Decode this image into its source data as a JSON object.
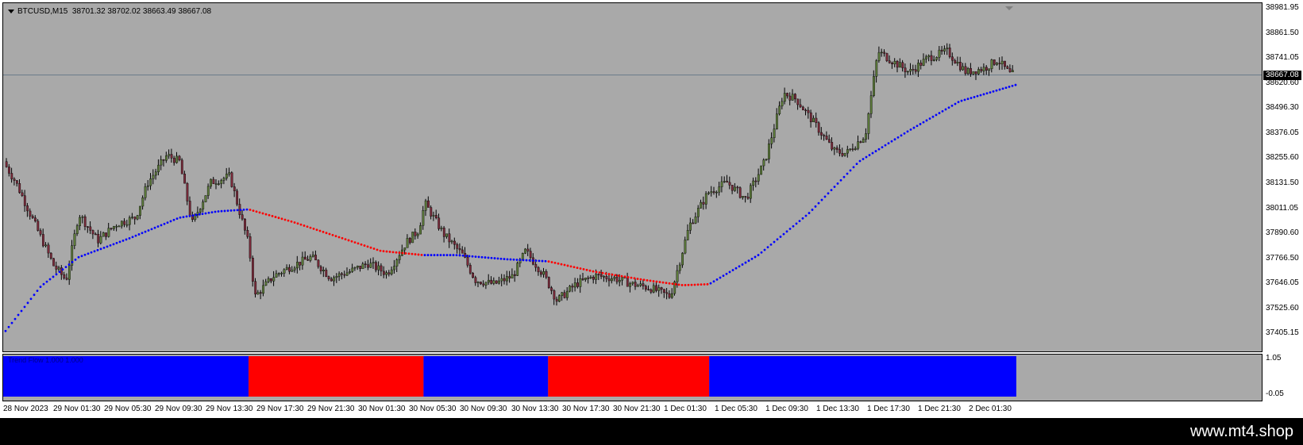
{
  "chart": {
    "symbol": "BTCUSD,M15",
    "ohlc": "38701.32 38702.02 38663.49 38667.08",
    "current_price": "38667.08"
  },
  "price_scale": {
    "labels": [
      "38981.95",
      "38861.50",
      "38741.05",
      "38620.60",
      "38496.30",
      "38376.05",
      "38255.60",
      "38131.50",
      "38011.05",
      "37890.60",
      "37766.50",
      "37646.05",
      "37525.60",
      "37405.15"
    ]
  },
  "time_axis": {
    "labels": [
      "28 Nov 2023",
      "29 Nov 01:30",
      "29 Nov 05:30",
      "29 Nov 09:30",
      "29 Nov 13:30",
      "29 Nov 17:30",
      "29 Nov 21:30",
      "30 Nov 01:30",
      "30 Nov 05:30",
      "30 Nov 09:30",
      "30 Nov 13:30",
      "30 Nov 17:30",
      "30 Nov 21:30",
      "1 Dec 01:30",
      "1 Dec 05:30",
      "1 Dec 09:30",
      "1 Dec 13:30",
      "1 Dec 17:30",
      "1 Dec 21:30",
      "2 Dec 01:30"
    ]
  },
  "indicator": {
    "name": "Trend Flow 1.000 1.000",
    "scale_top": "1.05",
    "scale_bottom": "-0.05",
    "colors": {
      "up": "#0000ff",
      "down": "#ff0000"
    },
    "segments": [
      {
        "from": 0,
        "to": 0.195,
        "state": "up"
      },
      {
        "from": 0.195,
        "to": 0.334,
        "state": "down"
      },
      {
        "from": 0.334,
        "to": 0.433,
        "state": "up"
      },
      {
        "from": 0.433,
        "to": 0.561,
        "state": "down"
      },
      {
        "from": 0.561,
        "to": 0.805,
        "state": "up"
      }
    ]
  },
  "footer": {
    "brand": "www.mt4.shop"
  },
  "colors": {
    "background": "#a9a9a9",
    "bull": "#5c7a3a",
    "bear": "#7a2a3a",
    "ma_up": "#0000ff",
    "ma_down": "#ff0000",
    "grid_line": "#6b7b8b"
  }
}
